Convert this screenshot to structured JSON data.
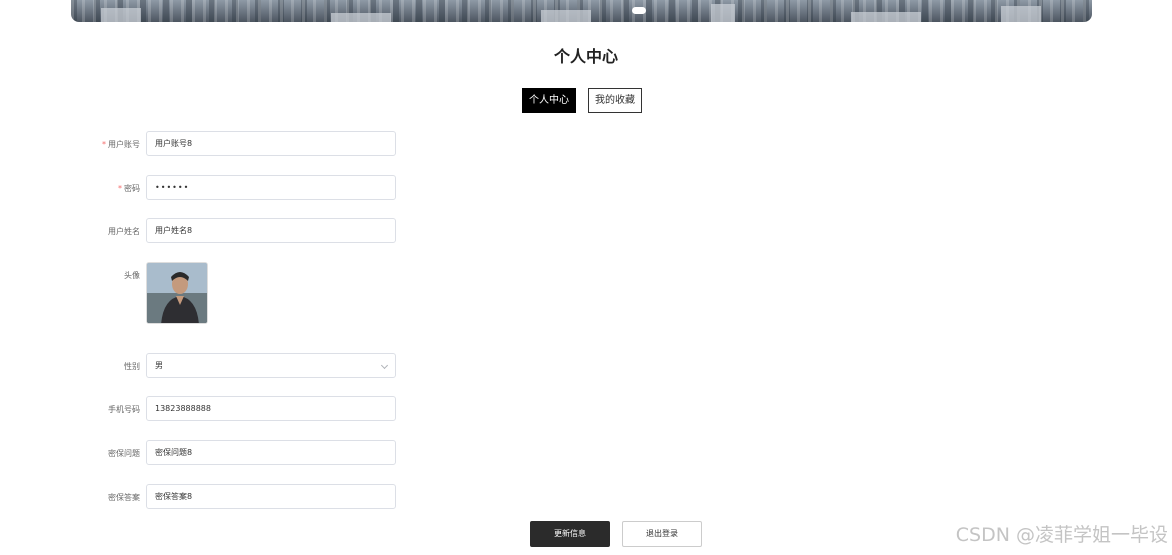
{
  "header": {
    "title": "个人中心"
  },
  "tabs": [
    {
      "label": "个人中心",
      "active": true
    },
    {
      "label": "我的收藏",
      "active": false
    }
  ],
  "form": {
    "account": {
      "label": "用户账号",
      "required": true,
      "value": "用户账号8"
    },
    "password": {
      "label": "密码",
      "required": true,
      "value": "••••••"
    },
    "name": {
      "label": "用户姓名",
      "value": "用户姓名8"
    },
    "avatar": {
      "label": "头像"
    },
    "gender": {
      "label": "性别",
      "value": "男"
    },
    "phone": {
      "label": "手机号码",
      "value": "13823888888"
    },
    "question": {
      "label": "密保问题",
      "value": "密保问题8"
    },
    "answer": {
      "label": "密保答案",
      "value": "密保答案8"
    }
  },
  "actions": {
    "update_label": "更新信息",
    "logout_label": "退出登录"
  },
  "watermark": "CSDN @凌菲学姐一毕设",
  "colors": {
    "primary": "#000000",
    "required": "#f56c6c",
    "border": "#dcdfe6"
  }
}
